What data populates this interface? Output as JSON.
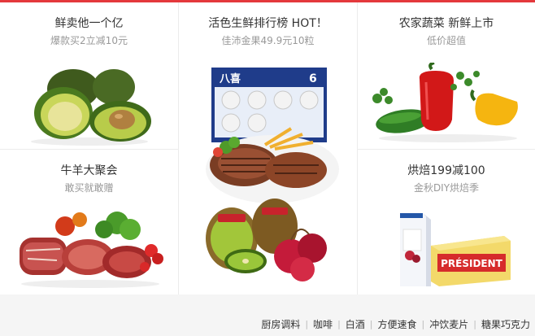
{
  "tiles": [
    {
      "title": "鲜卖他一个亿",
      "subtitle": "爆款买2立减10元",
      "image": "avocado-image"
    },
    {
      "title": "活色生鲜排行榜 HOT！",
      "subtitle": "佳沛金果49.9元10粒",
      "image": "fresh-food-collage-image",
      "box_brand": "八喜",
      "box_count": "6"
    },
    {
      "title": "农家蔬菜 新鲜上市",
      "subtitle": "低价超值",
      "image": "vegetables-image"
    },
    {
      "title": "牛羊大聚会",
      "subtitle": "敢买就敢赠",
      "image": "meat-image"
    },
    {
      "title": "烘焙199减100",
      "subtitle": "金秋DIY烘焙季",
      "image": "baking-products-image",
      "butter_brand": "PRÉSIDENT"
    }
  ],
  "footer": {
    "categories": [
      "厨房调料",
      "咖啡",
      "白酒",
      "方便速食",
      "冲饮麦片",
      "糖果巧克力"
    ]
  },
  "colors": {
    "accent": "#e4393c",
    "title": "#333333",
    "subtitle": "#999999",
    "footer_bg": "#f5f5f5"
  }
}
